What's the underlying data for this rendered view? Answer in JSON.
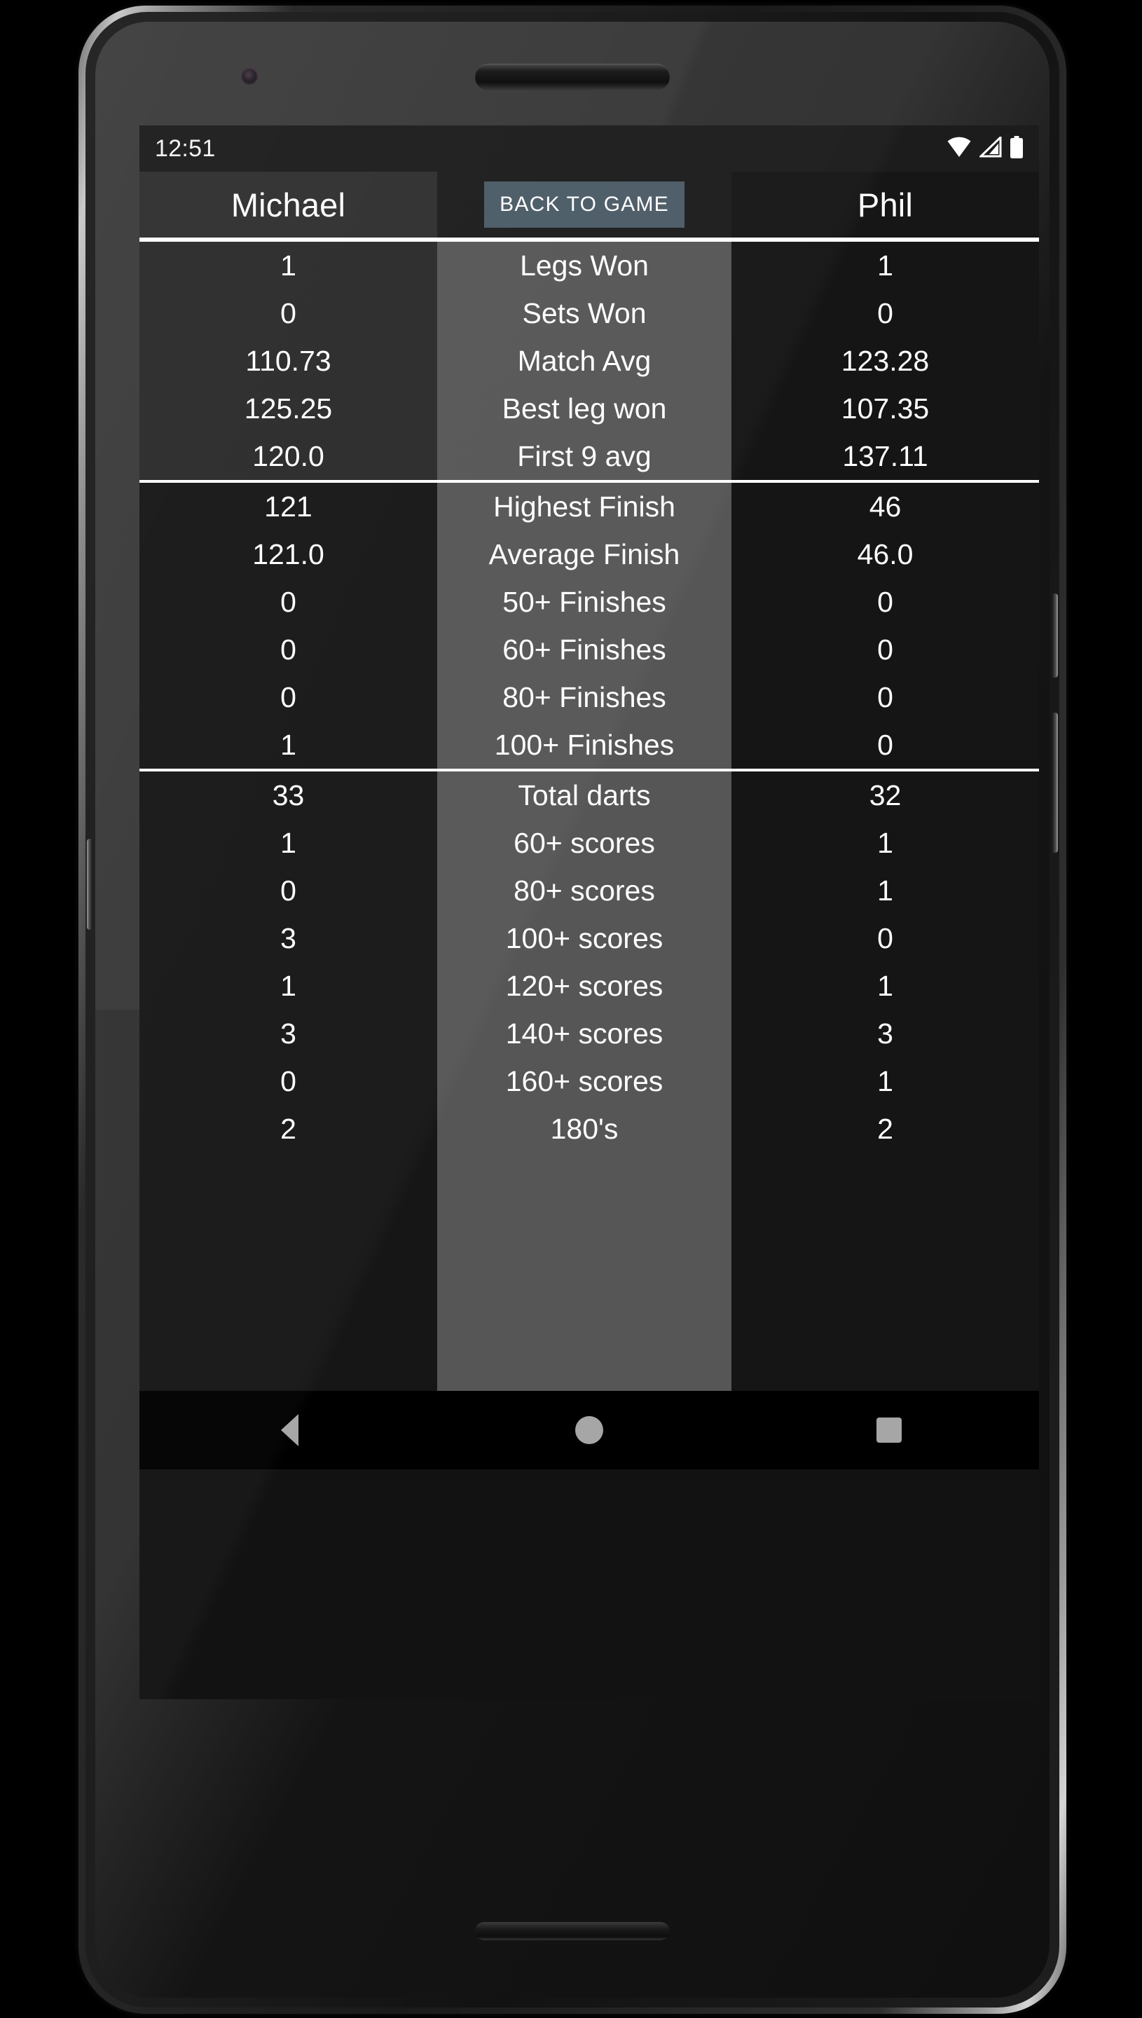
{
  "status_bar": {
    "clock": "12:51",
    "icons": [
      "wifi-icon",
      "cell-signal-icon",
      "battery-icon"
    ]
  },
  "header": {
    "player_left": "Michael",
    "player_right": "Phil",
    "back_button_label": "BACK TO GAME",
    "back_button_color": "#4b5b66"
  },
  "colors": {
    "screen_bg": "#121212",
    "left_column_bg": "#2a2a2a",
    "mid_column_bg": "#565656",
    "right_column_bg": "#151515",
    "divider": "#ffffff",
    "text": "#ffffff"
  },
  "stats": {
    "section_match": [
      {
        "left": "1",
        "label": "Legs Won",
        "right": "1"
      },
      {
        "left": "0",
        "label": "Sets Won",
        "right": "0"
      },
      {
        "left": "110.73",
        "label": "Match Avg",
        "right": "123.28"
      },
      {
        "left": "125.25",
        "label": "Best leg won",
        "right": "107.35"
      },
      {
        "left": "120.0",
        "label": "First 9 avg",
        "right": "137.11"
      }
    ],
    "section_finishes": [
      {
        "left": "121",
        "label": "Highest Finish",
        "right": "46"
      },
      {
        "left": "121.0",
        "label": "Average Finish",
        "right": "46.0"
      },
      {
        "left": "0",
        "label": "50+ Finishes",
        "right": "0"
      },
      {
        "left": "0",
        "label": "60+ Finishes",
        "right": "0"
      },
      {
        "left": "0",
        "label": "80+ Finishes",
        "right": "0"
      },
      {
        "left": "1",
        "label": "100+ Finishes",
        "right": "0"
      }
    ],
    "section_scores": [
      {
        "left": "33",
        "label": "Total darts",
        "right": "32"
      },
      {
        "left": "1",
        "label": "60+ scores",
        "right": "1"
      },
      {
        "left": "0",
        "label": "80+ scores",
        "right": "1"
      },
      {
        "left": "3",
        "label": "100+ scores",
        "right": "0"
      },
      {
        "left": "1",
        "label": "120+ scores",
        "right": "1"
      },
      {
        "left": "3",
        "label": "140+ scores",
        "right": "3"
      },
      {
        "left": "0",
        "label": "160+ scores",
        "right": "1"
      },
      {
        "left": "2",
        "label": "180's",
        "right": "2"
      }
    ]
  },
  "nav_bar": {
    "back": "back-triangle-icon",
    "home": "home-circle-icon",
    "recents": "recents-square-icon"
  }
}
